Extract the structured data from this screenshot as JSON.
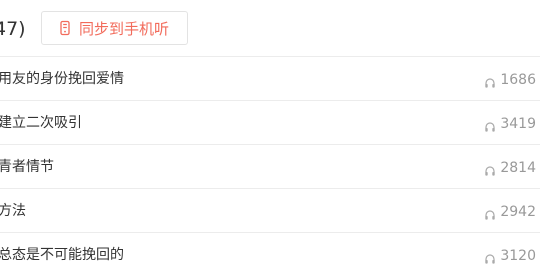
{
  "header": {
    "count_text": "47)",
    "sync_button_label": "同步到手机听",
    "sync_icon": "phone-icon",
    "accent_color": "#f26b5b"
  },
  "tracks": [
    {
      "title": "用友的身份挽回爱情",
      "plays": "1686",
      "icon": "headphone-icon"
    },
    {
      "title": "建立二次吸引",
      "plays": "3419",
      "icon": "headphone-icon"
    },
    {
      "title": "青者情节",
      "plays": "2814",
      "icon": "headphone-icon"
    },
    {
      "title": "方法",
      "plays": "2942",
      "icon": "headphone-icon"
    },
    {
      "title": "总态是不可能挽回的",
      "plays": "3120",
      "icon": "headphone-icon"
    }
  ]
}
